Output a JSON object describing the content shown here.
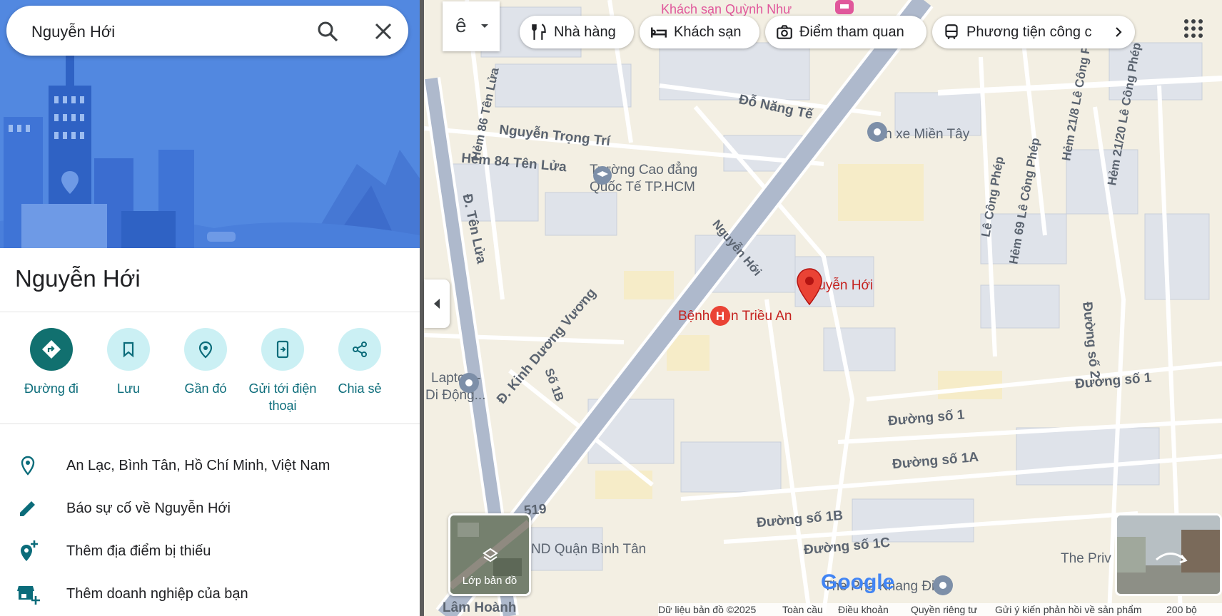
{
  "search": {
    "query": "Nguyễn Hới"
  },
  "place": {
    "title": "Nguyễn Hới"
  },
  "actions": [
    {
      "label": "Đường đi",
      "icon": "directions-icon"
    },
    {
      "label": "Lưu",
      "icon": "bookmark-icon"
    },
    {
      "label": "Gần đó",
      "icon": "nearby-icon"
    },
    {
      "label": "Gửi tới điện thoại",
      "icon": "send-to-phone-icon"
    },
    {
      "label": "Chia sẻ",
      "icon": "share-icon"
    }
  ],
  "info": [
    {
      "text": "An Lạc, Bình Tân, Hồ Chí Minh, Việt Nam",
      "icon": "location-pin-icon"
    },
    {
      "text": "Báo sự cố về Nguyễn Hới",
      "icon": "pencil-icon"
    },
    {
      "text": "Thêm địa điểm bị thiếu",
      "icon": "add-place-icon"
    },
    {
      "text": "Thêm doanh nghiệp của bạn",
      "icon": "add-business-icon"
    }
  ],
  "chips": [
    {
      "label": "Nhà hàng",
      "icon": "restaurant-icon"
    },
    {
      "label": "Khách sạn",
      "icon": "hotel-icon"
    },
    {
      "label": "Điểm tham quan",
      "icon": "camera-icon"
    },
    {
      "label": "Phương tiện công c",
      "icon": "transit-icon"
    }
  ],
  "lang_glyph": "ê",
  "map_labels": {
    "hotel": "Khách sạn Quỳnh Như",
    "do_nang_te": "Đỗ Năng Tế",
    "ben_xe": "Bến xe Miền Tây",
    "nguyen_trong_tri": "Nguyễn Trọng Trí",
    "hem86": "Hẻm 86 Tên Lửa",
    "hem84": "Hẻm 84 Tên Lửa",
    "truong_1": "Trường Cao đẳng",
    "truong_2": "Quốc Tế TP.HCM",
    "ten_lua": "Đ. Tên Lửa",
    "nguyen_hoi_street": "Nguyễn Hới",
    "pin_label": "Nguyễn Hới",
    "benh_vien": "Bệnh viện Triều An",
    "kinh_duong_vuong": "Đ. Kinh Dương Vương",
    "so1b_vert": "Số 1B",
    "laptop_1": "Laptop -",
    "laptop_2": "Di Động...",
    "duong_so_1_a": "Đường số 1",
    "duong_so_1_b": "Đường số 1",
    "duong_so_1a": "Đường số 1A",
    "duong_so_1b": "Đường số 1B",
    "duong_so_1c": "Đường số 1C",
    "duong_so_2": "Đường số 2",
    "le_cong_phep": "Lê Công Phép",
    "hem69": "Hẻm 69 Lê Công Phép",
    "hem21_8": "Hẻm 21/8 Lê Công Phép",
    "hem21_20": "Hẻm 21/20 Lê Công Phép",
    "nd_binh_tan": "ND Quận Bình Tân",
    "the_priv": "The Priv",
    "khang_dien": "The Pha Khang Điền",
    "lam_hoanh": "Lâm Hoành",
    "n519": "519"
  },
  "layers_label": "Lớp bản đồ",
  "google_logo": "Google",
  "footer": {
    "data": "Dữ liệu bản đồ ©2025",
    "global": "Toàn cầu",
    "terms": "Điều khoản",
    "privacy": "Quyền riêng tư",
    "feedback": "Gửi ý kiến phản hồi về sản phẩm",
    "scale": "200 bộ"
  },
  "colors": {
    "accent": "#11706f",
    "pin": "#ea4335",
    "hero_bg": "#5288e0"
  }
}
